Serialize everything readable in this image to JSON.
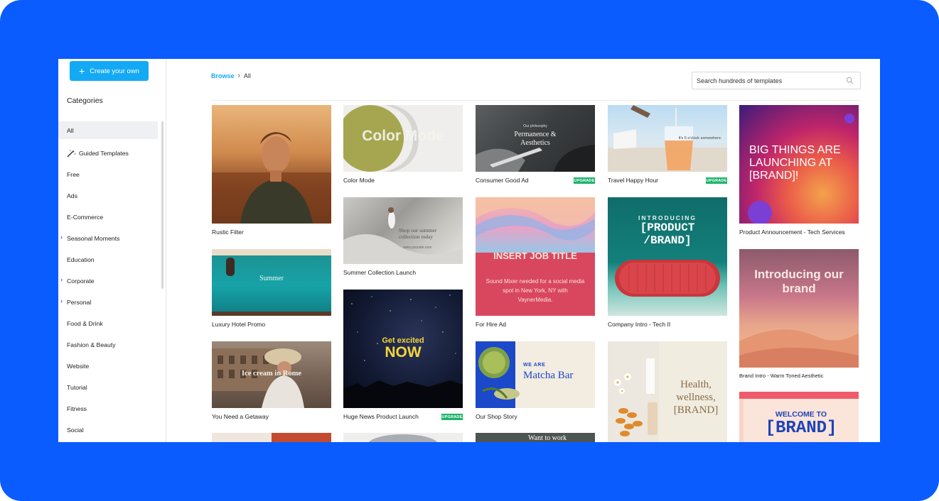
{
  "sidebar": {
    "create_label": "Create your own",
    "categories_title": "Categories",
    "items": [
      {
        "label": "All",
        "active": true,
        "chevron": false,
        "icon": ""
      },
      {
        "label": "Guided Templates",
        "active": false,
        "chevron": false,
        "icon": "magic-wand-icon"
      },
      {
        "label": "Free",
        "active": false,
        "chevron": false,
        "icon": ""
      },
      {
        "label": "Ads",
        "active": false,
        "chevron": false,
        "icon": ""
      },
      {
        "label": "E-Commerce",
        "active": false,
        "chevron": false,
        "icon": ""
      },
      {
        "label": "Seasonal Moments",
        "active": false,
        "chevron": true,
        "icon": ""
      },
      {
        "label": "Education",
        "active": false,
        "chevron": false,
        "icon": ""
      },
      {
        "label": "Corporate",
        "active": false,
        "chevron": true,
        "icon": ""
      },
      {
        "label": "Personal",
        "active": false,
        "chevron": true,
        "icon": ""
      },
      {
        "label": "Food & Drink",
        "active": false,
        "chevron": false,
        "icon": ""
      },
      {
        "label": "Fashion & Beauty",
        "active": false,
        "chevron": false,
        "icon": ""
      },
      {
        "label": "Website",
        "active": false,
        "chevron": false,
        "icon": ""
      },
      {
        "label": "Tutorial",
        "active": false,
        "chevron": false,
        "icon": ""
      },
      {
        "label": "Fitness",
        "active": false,
        "chevron": false,
        "icon": ""
      },
      {
        "label": "Social",
        "active": false,
        "chevron": false,
        "icon": ""
      }
    ]
  },
  "breadcrumb": {
    "root": "Browse",
    "separator": "›",
    "current": "All"
  },
  "search": {
    "placeholder": "Search hundreds of templates"
  },
  "badge_text": "UPGRADE",
  "colors": {
    "frame": "#0a5cff",
    "accent": "#14a9f5",
    "badge": "#1db36b"
  },
  "templates": {
    "rustic": {
      "label": "Rustic Filter"
    },
    "color_mode": {
      "label": "Color Mode",
      "overlay": "Color Mode"
    },
    "consumer": {
      "label": "Consumer Good Ad",
      "overlay_small": "Our philosophy",
      "overlay": "Permanence & Aesthetics",
      "upgrade": true
    },
    "travel": {
      "label": "Travel Happy Hour",
      "overlay": "It's 5 o'clock somewhere.",
      "upgrade": true
    },
    "product": {
      "label": "Product Announcement - Tech Services",
      "overlay": "BIG THINGS ARE LAUNCHING AT [BRAND]!"
    },
    "summer": {
      "label": "Summer Collection Launch",
      "overlay": "Shop our summer collection today",
      "url": "www.yoursite.com"
    },
    "hire": {
      "label": "For Hire Ad",
      "overlay": "INSERT JOB TITLE",
      "body": "Sound Mixer needed for a social media spot in New York, NY with VaynerMedia."
    },
    "company": {
      "label": "Company Intro - Tech II",
      "overlay_small": "INTRODUCING",
      "overlay": "[PRODUCT /BRAND]"
    },
    "luxury": {
      "label": "Luxury Hotel Promo",
      "overlay": "Summer"
    },
    "brand_intro": {
      "label": "Brand Intro - Warm Toned Aesthetic",
      "overlay": "Introducing our brand"
    },
    "getaway": {
      "label": "You Need a Getaway",
      "overlay": "Ice cream in Rome"
    },
    "news": {
      "label": "Huge News Product Launch",
      "overlay_small": "Get excited",
      "overlay": "NOW",
      "upgrade": true
    },
    "shop": {
      "label": "Our Shop Story",
      "overlay_small": "WE ARE",
      "overlay": "Matcha Bar"
    },
    "health": {
      "overlay": "Health, wellness, [BRAND]"
    },
    "welcome": {
      "overlay_small": "WELCOME TO",
      "overlay": "[BRAND]"
    },
    "work": {
      "overlay": "Want to work"
    }
  }
}
